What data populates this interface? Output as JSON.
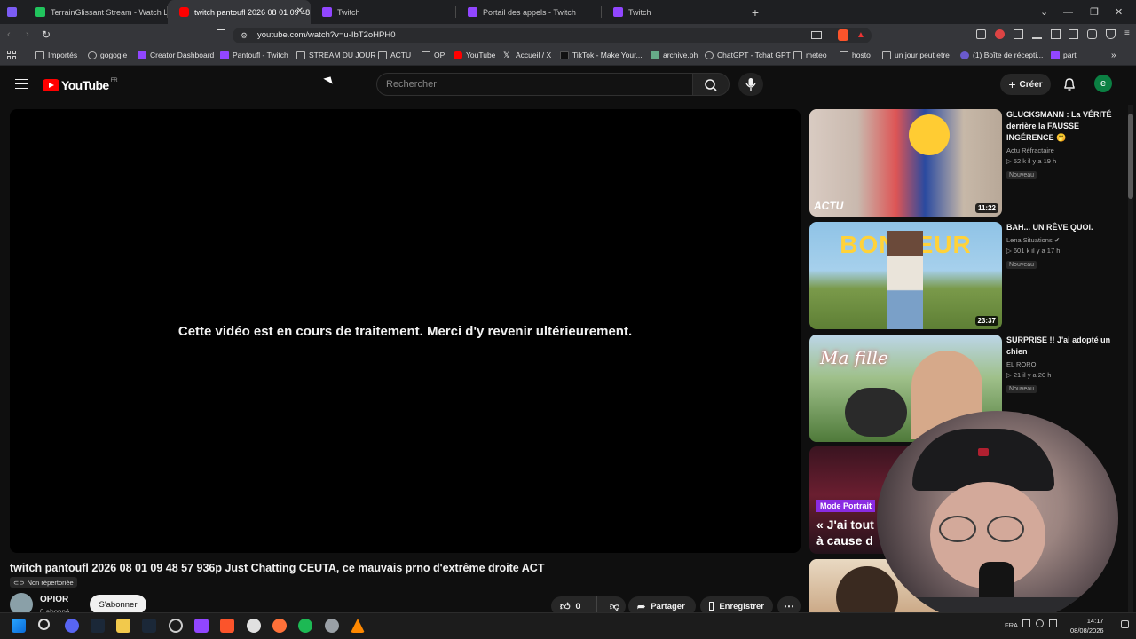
{
  "browser": {
    "tabs": [
      {
        "title": "TerrainGlissant Stream - Watch Live o",
        "color": "#21c45d"
      },
      {
        "title": "twitch pantoufl 2026 08 01 09 48",
        "color": "#ff0000"
      },
      {
        "title": "Twitch",
        "color": "#9146ff"
      },
      {
        "title": "Portail des appels - Twitch",
        "color": "#9146ff"
      },
      {
        "title": "Twitch",
        "color": "#9146ff"
      }
    ],
    "url": "youtube.com/watch?v=u-IbT2oHPH0",
    "bookmarks": [
      "Importés",
      "gogogle",
      "Creator Dashboard",
      "Pantoufl - Twitch",
      "STREAM DU JOUR",
      "ACTU",
      "OP",
      "YouTube",
      "Accueil / X",
      "TikTok - Make Your...",
      "archive.ph",
      "ChatGPT - Tchat GPT",
      "meteo",
      "hosto",
      "un jour peut etre",
      "(1) Boîte de récepti...",
      "part"
    ]
  },
  "youtube": {
    "logo_text": "YouTube",
    "region": "FR",
    "search_placeholder": "Rechercher",
    "create_label": "Créer",
    "avatar_letter": "e",
    "brand_red": "#ff0000"
  },
  "video": {
    "processing_message": "Cette vidéo est en cours de traitement. Merci d'y revenir ultérieurement.",
    "title": "twitch pantoufl 2026 08 01 09 48 57 936p Just Chatting CEUTA, ce mauvais prno d'extrême droite ACT",
    "visibility": "Non répertoriée",
    "channel": "OPIOR",
    "subscribers": "0 abonné",
    "subscribe_label": "S'abonner",
    "likes": "0",
    "share_label": "Partager",
    "save_label": "Enregistrer"
  },
  "recommendations": [
    {
      "title": "GLUCKSMANN : La VÉRITÉ derrière la FAUSSE INGÉRENCE 🤭",
      "channel": "Actu Réfractaire",
      "stats": "▷ 52 k  il y a 19 h",
      "badge": "Nouveau",
      "duration": "11:22",
      "thumb_text": "ACTU"
    },
    {
      "title": "BAH... UN RÊVE QUOI.",
      "channel": "Lena Situations",
      "stats": "▷ 601 k  il y a 17 h",
      "badge": "Nouveau",
      "duration": "23:37",
      "thumb_text": "BONHEUR"
    },
    {
      "title": "SURPRISE !! J'ai adopté un chien",
      "channel": "EL RORO",
      "stats": "▷ 21  il y a 20 h",
      "badge": "Nouveau",
      "duration": "",
      "thumb_text": "Ma fille"
    },
    {
      "title": "",
      "channel": "",
      "stats": "",
      "badge": "",
      "duration": "",
      "thumb_text": "« J'ai tout",
      "thumb_text2": "à cause d",
      "label": "Mode Portrait"
    }
  ],
  "taskbar": {
    "language": "FRA",
    "time": "14:17",
    "date": "08/08/2026"
  }
}
